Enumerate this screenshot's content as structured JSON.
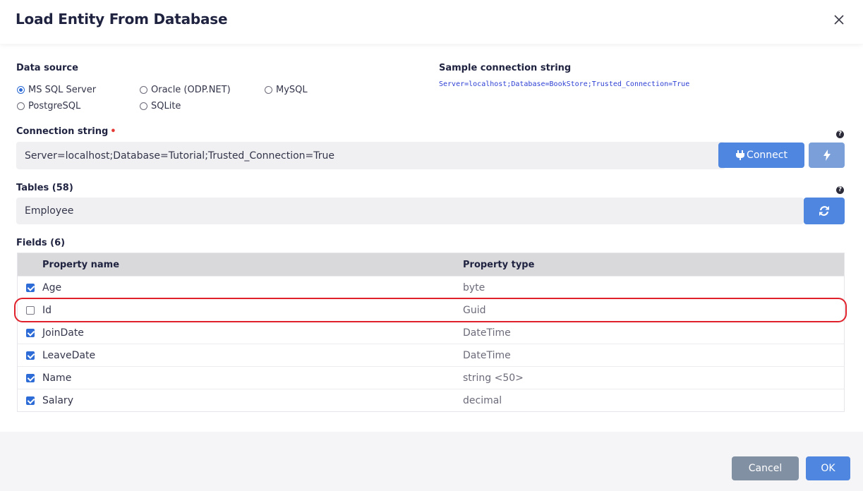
{
  "dialog": {
    "title": "Load Entity From Database"
  },
  "data_source": {
    "label": "Data source",
    "options": [
      {
        "label": "MS SQL Server",
        "checked": true
      },
      {
        "label": "Oracle (ODP.NET)",
        "checked": false
      },
      {
        "label": "MySQL",
        "checked": false
      },
      {
        "label": "PostgreSQL",
        "checked": false
      },
      {
        "label": "SQLite",
        "checked": false
      }
    ]
  },
  "sample": {
    "label": "Sample connection string",
    "value": "Server=localhost;Database=BookStore;Trusted_Connection=True"
  },
  "connection": {
    "label": "Connection string",
    "required_mark": "•",
    "value": "Server=localhost;Database=Tutorial;Trusted_Connection=True",
    "connect_label": "Connect",
    "help": "?"
  },
  "tables": {
    "label": "Tables (58)",
    "selected": "Employee",
    "help": "?"
  },
  "fields": {
    "label": "Fields (6)",
    "columns": [
      "Property name",
      "Property type"
    ],
    "rows": [
      {
        "name": "Age",
        "type": "byte",
        "checked": true
      },
      {
        "name": "Id",
        "type": "Guid",
        "checked": false
      },
      {
        "name": "JoinDate",
        "type": "DateTime",
        "checked": true
      },
      {
        "name": "LeaveDate",
        "type": "DateTime",
        "checked": true
      },
      {
        "name": "Name",
        "type": "string <50>",
        "checked": true
      },
      {
        "name": "Salary",
        "type": "decimal",
        "checked": true
      }
    ]
  },
  "footer": {
    "cancel_label": "Cancel",
    "ok_label": "OK"
  },
  "icons": {
    "close": "close-icon",
    "plug": "plug-icon",
    "bolt": "bolt-icon",
    "refresh": "refresh-icon",
    "help": "help-icon"
  },
  "colors": {
    "accent": "#4f86e0",
    "checked": "#2d6bd6",
    "highlight": "#e0202a",
    "cancel": "#8290a3",
    "sample_text": "#2d3fd3"
  }
}
